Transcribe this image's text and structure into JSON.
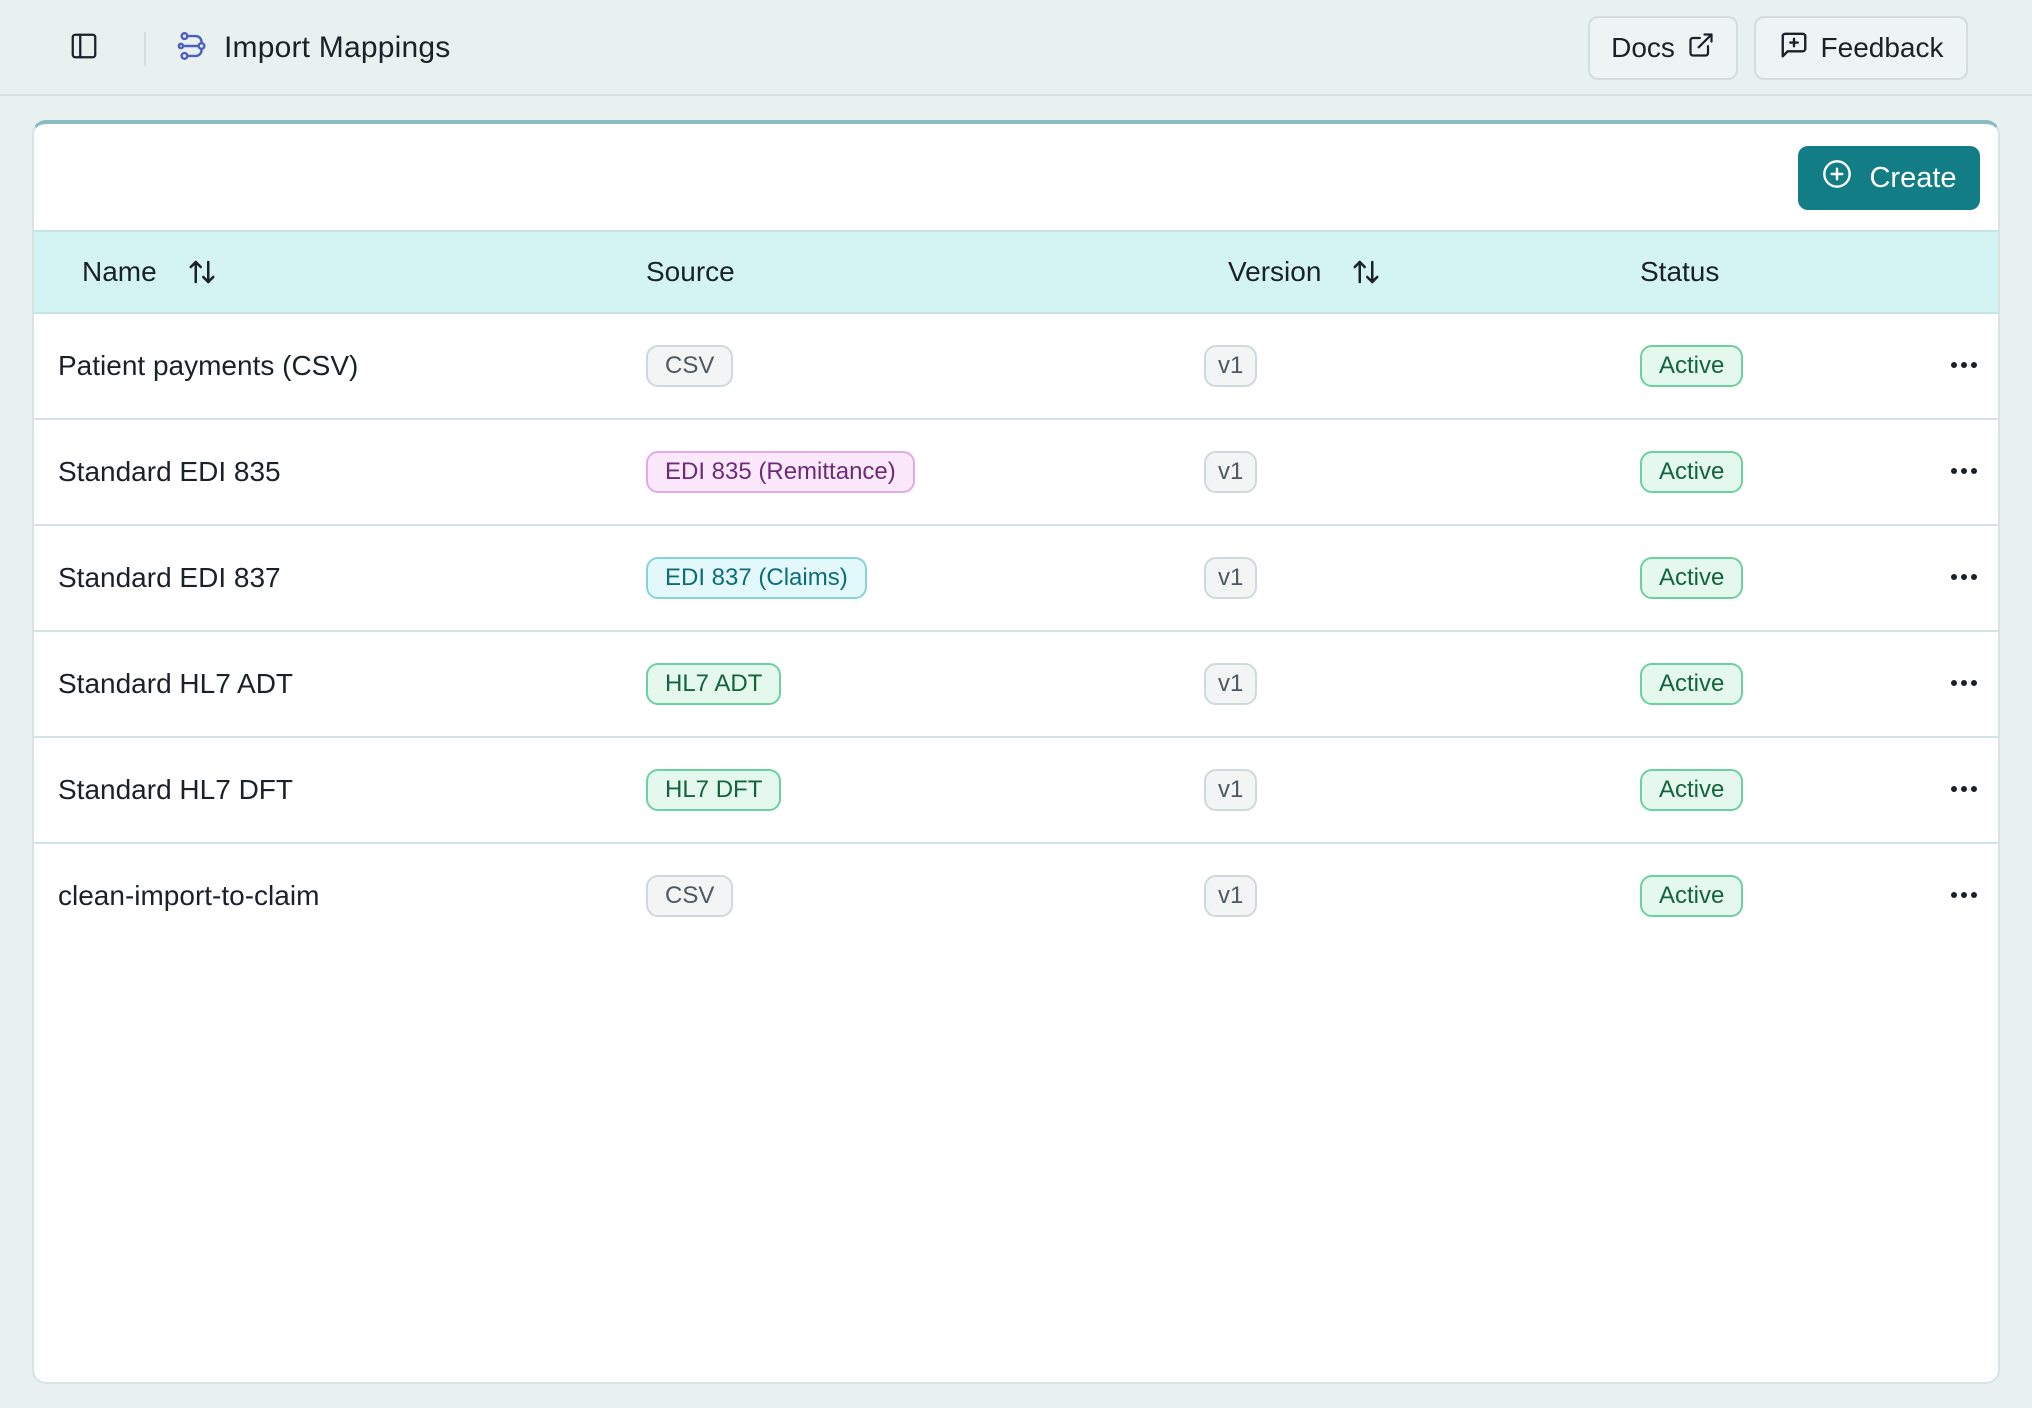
{
  "header": {
    "title": "Import Mappings",
    "docs_label": "Docs",
    "feedback_label": "Feedback"
  },
  "toolbar": {
    "create_label": "Create"
  },
  "table": {
    "columns": {
      "name": "Name",
      "source": "Source",
      "version": "Version",
      "status": "Status"
    },
    "rows": [
      {
        "name": "Patient payments (CSV)",
        "source": "CSV",
        "source_style": "gray",
        "version": "v1",
        "status": "Active"
      },
      {
        "name": "Standard EDI 835",
        "source": "EDI 835 (Remittance)",
        "source_style": "purple",
        "version": "v1",
        "status": "Active"
      },
      {
        "name": "Standard EDI 837",
        "source": "EDI 837 (Claims)",
        "source_style": "cyan",
        "version": "v1",
        "status": "Active"
      },
      {
        "name": "Standard HL7 ADT",
        "source": "HL7 ADT",
        "source_style": "green",
        "version": "v1",
        "status": "Active"
      },
      {
        "name": "Standard HL7 DFT",
        "source": "HL7 DFT",
        "source_style": "green",
        "version": "v1",
        "status": "Active"
      },
      {
        "name": "clean-import-to-claim",
        "source": "CSV",
        "source_style": "gray",
        "version": "v1",
        "status": "Active"
      }
    ]
  },
  "icons": {
    "sidebar_toggle": "sidebar-panel-icon",
    "title_icon": "workflow-nodes-icon",
    "docs": "external-link-icon",
    "feedback": "message-plus-icon",
    "create": "plus-circle-icon",
    "sort": "sort-arrows-icon",
    "row_menu": "more-horizontal-icon"
  },
  "colors": {
    "accent": "#137d86",
    "header_bg": "#d4f3f3",
    "page_bg": "#e9f0f0",
    "badge_gray": {
      "bg": "#f3f5f5",
      "border": "#cfd8da",
      "text": "#4d5860"
    },
    "badge_purple": {
      "bg": "#fbe9fb",
      "border": "#e3a9e6",
      "text": "#6e2b7a"
    },
    "badge_cyan": {
      "bg": "#e3f8fa",
      "border": "#86d3dd",
      "text": "#0c6d78"
    },
    "badge_green": {
      "bg": "#e4f8ee",
      "border": "#6dd0a0",
      "text": "#13643c"
    }
  }
}
